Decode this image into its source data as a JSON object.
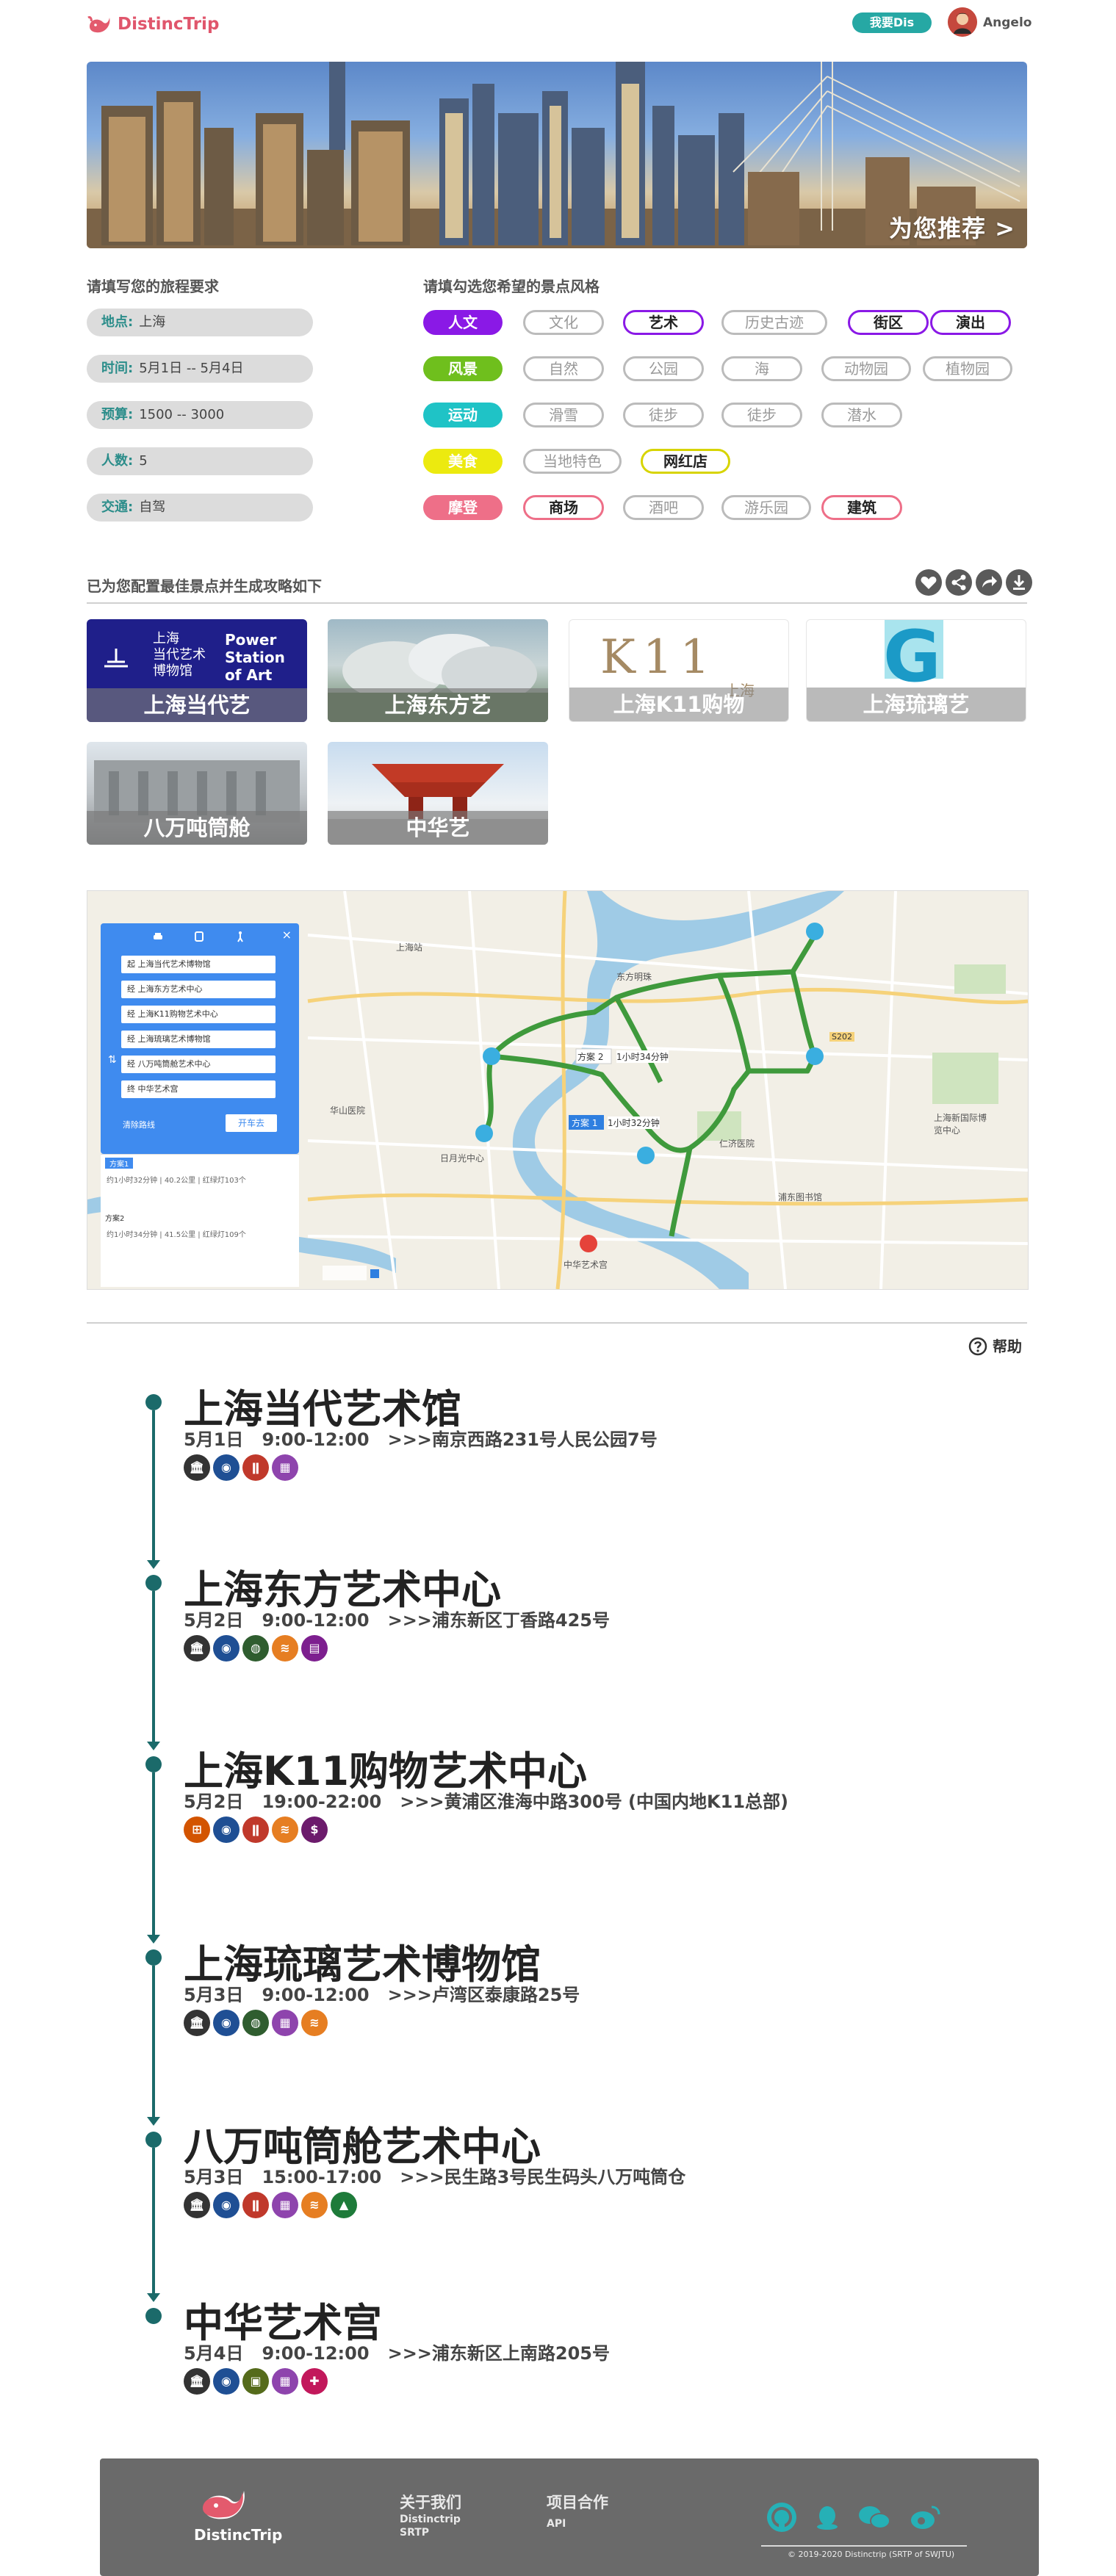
{
  "header": {
    "logo_text": "DistincTrip",
    "mine_button": "我要Dis",
    "username": "Angelo"
  },
  "banner": {
    "cta": "为您推荐 >"
  },
  "form": {
    "title": "请填写您的旅程要求",
    "fields": [
      {
        "label": "地点:",
        "value": "上海"
      },
      {
        "label": "时间:",
        "value": "5月1日 -- 5月4日"
      },
      {
        "label": "预算:",
        "value": "1500 -- 3000"
      },
      {
        "label": "人数:",
        "value": "5"
      },
      {
        "label": "交通:",
        "value": "自驾"
      }
    ]
  },
  "styles": {
    "title": "请填勾选您希望的景点风格",
    "rows": [
      {
        "category": "人文",
        "color": "#8a19e6",
        "sel_border": "#8a19e6",
        "tags": [
          {
            "label": "文化",
            "selected": false
          },
          {
            "label": "艺术",
            "selected": true
          },
          {
            "label": "历史古迹",
            "selected": false
          },
          {
            "label": "街区",
            "selected": true
          },
          {
            "label": "演出",
            "selected": true
          }
        ]
      },
      {
        "category": "风景",
        "color": "#6fbf1d",
        "sel_border": "#6fbf1d",
        "tags": [
          {
            "label": "自然",
            "selected": false
          },
          {
            "label": "公园",
            "selected": false
          },
          {
            "label": "海",
            "selected": false
          },
          {
            "label": "动物园",
            "selected": false
          },
          {
            "label": "植物园",
            "selected": false
          }
        ]
      },
      {
        "category": "运动",
        "color": "#1fc3c6",
        "sel_border": "#1fc3c6",
        "tags": [
          {
            "label": "滑雪",
            "selected": false
          },
          {
            "label": "徒步",
            "selected": false
          },
          {
            "label": "徒步",
            "selected": false
          },
          {
            "label": "潜水",
            "selected": false
          }
        ]
      },
      {
        "category": "美食",
        "color": "#ecea0f",
        "sel_border": "#d7d400",
        "tags": [
          {
            "label": "当地特色",
            "selected": false
          },
          {
            "label": "网红店",
            "selected": true
          }
        ]
      },
      {
        "category": "摩登",
        "color": "#ee6f88",
        "sel_border": "#ee6f88",
        "tags": [
          {
            "label": "商场",
            "selected": true
          },
          {
            "label": "酒吧",
            "selected": false
          },
          {
            "label": "游乐园",
            "selected": false
          },
          {
            "label": "建筑",
            "selected": true
          }
        ]
      }
    ]
  },
  "attractions": {
    "title": "已为您配置最佳景点并生成攻略如下",
    "cards": [
      {
        "caption": "上海当代艺"
      },
      {
        "caption": "上海东方艺"
      },
      {
        "caption": "上海K11购物"
      },
      {
        "caption": "上海琉璃艺"
      },
      {
        "caption": "八万吨筒舱"
      },
      {
        "caption": "中华艺"
      }
    ],
    "power_station_cn": [
      "上海",
      "当代艺术",
      "博物馆"
    ],
    "power_station_en": [
      "Power",
      "Station",
      "of Art"
    ],
    "k11_text": "K11",
    "k11_sub": "上海",
    "glass_letter": "G"
  },
  "map": {
    "panel_rows": [
      "起 上海当代艺术博物馆",
      "经 上海东方艺术中心",
      "经 上海K11购物艺术中心",
      "经 上海琉璃艺术博物馆",
      "经 八万吨筒舱艺术中心",
      "终 中华艺术宫"
    ],
    "panel_clear": "清除路线",
    "panel_go": "开车去",
    "plan1": "方案1",
    "plan1_detail": "约1小时32分钟 | 40.2公里 | 红绿灯103个",
    "plan2": "方案2",
    "plan2_detail": "约1小时34分钟 | 41.5公里 | 红绿灯109个",
    "route_label_1": "方案 1",
    "route_time_1": "1小时32分钟",
    "route_label_2": "方案 2",
    "route_time_2": "1小时34分钟",
    "places": [
      "上海站",
      "东方明珠",
      "华山医院",
      "日月光中心",
      "仁济医院",
      "上海新国际博览中心",
      "浦东图书馆",
      "中华艺术宫",
      "S202"
    ]
  },
  "help_label": "帮助",
  "itinerary": [
    {
      "name": "上海当代艺术馆",
      "meta": "5月1日   9:00-12:00   >>>南京西路231号人民公园7号",
      "icons": [
        "museum-icon",
        "camera-icon",
        "food-icon",
        "qr-icon"
      ]
    },
    {
      "name": "上海东方艺术中心",
      "meta": "5月2日   9:00-12:00   >>>浦东新区丁香路425号",
      "icons": [
        "museum-icon",
        "camera-icon",
        "car-icon",
        "wifi-icon",
        "book-icon"
      ]
    },
    {
      "name": "上海K11购物艺术中心",
      "meta": "5月2日   19:00-22:00   >>>黄浦区淮海中路300号 (中国内地K11总部)",
      "icons": [
        "cart-icon",
        "camera-icon",
        "food-icon",
        "wifi-icon",
        "money-icon"
      ]
    },
    {
      "name": "上海琉璃艺术博物馆",
      "meta": "5月3日   9:00-12:00   >>>卢湾区泰康路25号",
      "icons": [
        "museum-icon",
        "camera-icon",
        "car-icon",
        "qr-icon",
        "wifi-icon"
      ]
    },
    {
      "name": "八万吨筒舱艺术中心",
      "meta": "5月3日   15:00-17:00   >>>民生路3号民生码头八万吨筒仓",
      "icons": [
        "museum-icon",
        "camera-icon",
        "food-icon",
        "qr-icon",
        "wifi-icon",
        "guide-icon"
      ]
    },
    {
      "name": "中华艺术宫",
      "meta": "5月4日   9:00-12:00   >>>浦东新区上南路205号",
      "icons": [
        "museum-icon",
        "camera-icon",
        "bus-icon",
        "qr-icon",
        "medical-icon"
      ]
    }
  ],
  "footer": {
    "logo_text": "DistincTrip",
    "about_title": "关于我们",
    "about_lines": [
      "Distinctrip",
      "SRTP"
    ],
    "coop_title": "项目合作",
    "coop_lines": [
      "API"
    ],
    "copyright": "© 2019-2020 Distinctrip (SRTP of SWJTU)"
  }
}
